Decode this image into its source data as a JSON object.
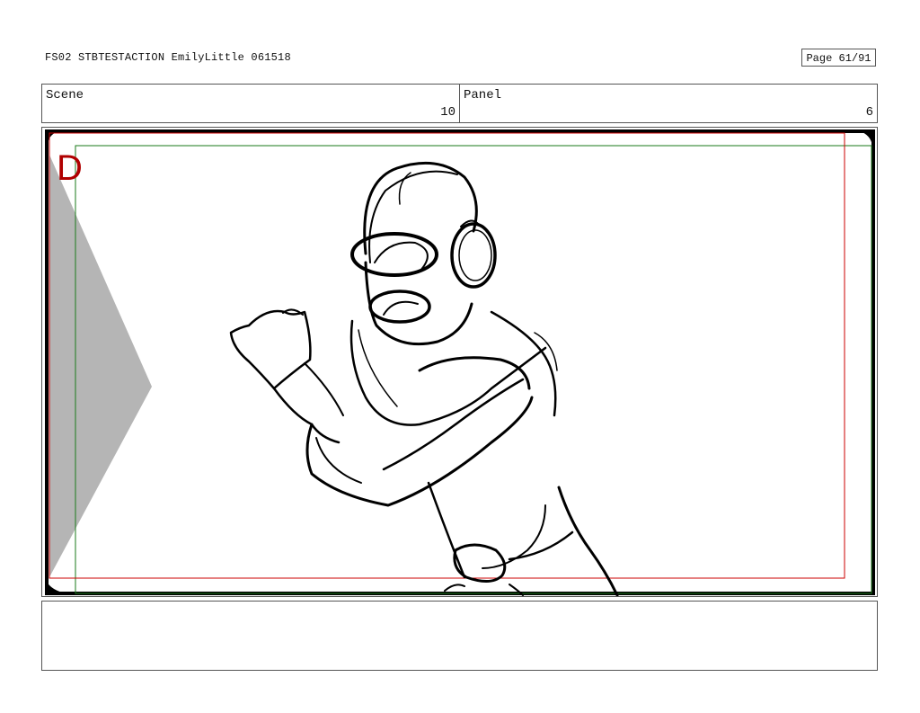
{
  "header": {
    "title": "FS02 STBTESTACTION EmilyLittle 061518",
    "page": "Page 61/91"
  },
  "info": {
    "scene_label": "Scene",
    "scene_value": "10",
    "panel_label": "Panel",
    "panel_value": "6"
  },
  "panel": {
    "corner_mark": "D",
    "safe_color": "#cc0000",
    "action_color": "#007700"
  },
  "notes": {
    "text": ""
  }
}
